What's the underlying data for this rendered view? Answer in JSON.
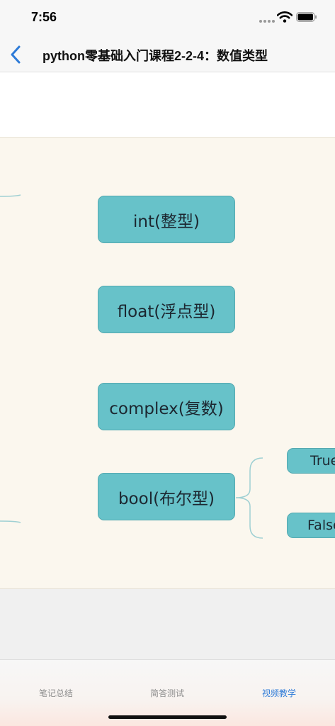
{
  "status_bar": {
    "time": "7:56",
    "icons": [
      "cellular-dots-icon",
      "wifi-icon",
      "battery-icon"
    ]
  },
  "nav": {
    "back_icon": "chevron-left-icon",
    "title": "python零基础入门课程2-2-4：数值类型"
  },
  "video": {
    "nodes": [
      {
        "label": "int(整型)"
      },
      {
        "label": "float(浮点型)"
      },
      {
        "label": "complex(复数)"
      },
      {
        "label": "bool(布尔型)"
      }
    ],
    "bool_children": [
      {
        "label": "True"
      },
      {
        "label": "False"
      }
    ]
  },
  "tabs": [
    {
      "label": "笔记总结",
      "active": false
    },
    {
      "label": "简答测试",
      "active": false
    },
    {
      "label": "视频教学",
      "active": true
    }
  ],
  "colors": {
    "accent": "#2e7bd8",
    "node_fill": "#67c2c9",
    "video_background": "#fbf7ee"
  }
}
